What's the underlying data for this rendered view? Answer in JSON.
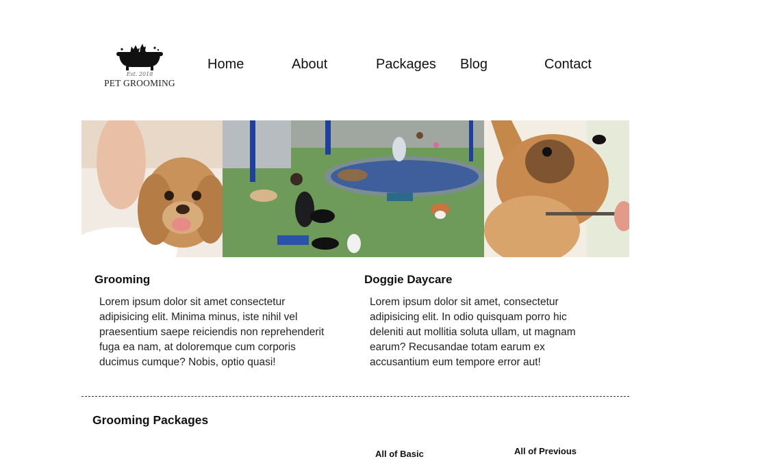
{
  "logo": {
    "est": "Est. 2018",
    "name": "PET GROOMING",
    "icon": "bathtub-dog-icon"
  },
  "nav": {
    "items": [
      "Home",
      "About",
      "Packages",
      "Blog",
      "Contact"
    ]
  },
  "hero": {
    "photos": [
      "wet-puppy-photo",
      "dog-park-fountain-photo",
      "yorkie-haircut-photo"
    ]
  },
  "services": [
    {
      "title": "Grooming",
      "text": "Lorem ipsum dolor sit amet consectetur adipisicing elit. Minima minus, iste nihil vel praesentium saepe reiciendis non reprehenderit fuga ea nam, at doloremque cum corporis ducimus cumque? Nobis, optio quasi!"
    },
    {
      "title": "Doggie Daycare",
      "text": "Lorem ipsum dolor sit amet, consectetur adipisicing elit. In odio quisquam porro hic deleniti aut mollitia soluta ullam, ut magnam earum? Recusandae totam earum ex accusantium eum tempore error aut!"
    }
  ],
  "packages": {
    "title": "Grooming Packages",
    "cut_label_1": "All of Basic",
    "cut_label_2": "All of Previous"
  }
}
